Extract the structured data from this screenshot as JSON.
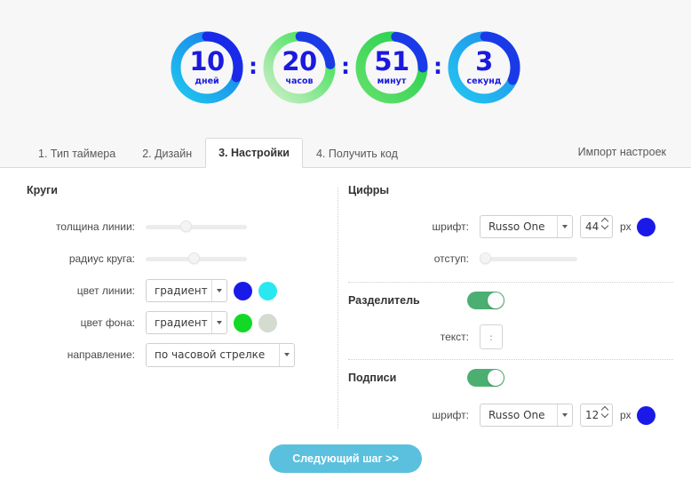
{
  "preview": {
    "units": [
      {
        "value": "10",
        "label": "дней",
        "ring_from": "#1ec8f0",
        "ring_to": "#1b74e8",
        "arc_color": "#1a2ae8",
        "arc_pct": 30,
        "arc_start_deg": 0
      },
      {
        "value": "20",
        "label": "часов",
        "ring_from": "#cdeec9",
        "ring_to": "#2fe04a",
        "arc_color": "#1a3ae8",
        "arc_pct": 22,
        "arc_start_deg": 2
      },
      {
        "value": "51",
        "label": "минут",
        "ring_from": "#63e06a",
        "ring_to": "#22cf4e",
        "arc_color": "#1a3ae8",
        "arc_pct": 22,
        "arc_start_deg": 8
      },
      {
        "value": "3",
        "label": "секунд",
        "ring_from": "#23c6f2",
        "ring_to": "#1f8ae8",
        "arc_color": "#1a3ae8",
        "arc_pct": 30,
        "arc_start_deg": 0
      }
    ],
    "separator": ":"
  },
  "tabs": {
    "items": [
      {
        "label": "1. Тип таймера",
        "active": false
      },
      {
        "label": "2. Дизайн",
        "active": false
      },
      {
        "label": "3. Настройки",
        "active": true
      },
      {
        "label": "4. Получить код",
        "active": false
      }
    ],
    "import_label": "Импорт настроек"
  },
  "circles": {
    "title": "Круги",
    "line_thickness": {
      "label": "толщина линии:",
      "value_pct": 35
    },
    "circle_radius": {
      "label": "радиус круга:",
      "value_pct": 43
    },
    "line_color": {
      "label": "цвет линии:",
      "mode": "градиент",
      "color_1": "#1a1ae8",
      "color_2": "#2ae8ef"
    },
    "bg_color": {
      "label": "цвет фона:",
      "mode": "градиент",
      "color_1": "#12d925",
      "color_2": "#d4dcd0"
    },
    "direction": {
      "label": "направление:",
      "value": "по часовой стрелке"
    }
  },
  "digits": {
    "title": "Цифры",
    "font": {
      "label": "шрифт:",
      "family": "Russo One",
      "size": "44",
      "unit": "px",
      "color": "#1a1ae8"
    },
    "indent": {
      "label": "отступ:",
      "value_pct": 2
    }
  },
  "separator_section": {
    "title": "Разделитель",
    "enabled": true,
    "text": {
      "label": "текст:",
      "value": ":"
    }
  },
  "captions": {
    "title": "Подписи",
    "enabled": true,
    "font": {
      "label": "шрифт:",
      "family": "Russo One",
      "size": "12",
      "unit": "px",
      "color": "#1a1ae8"
    }
  },
  "footer": {
    "next_label": "Следующий шаг >>"
  }
}
